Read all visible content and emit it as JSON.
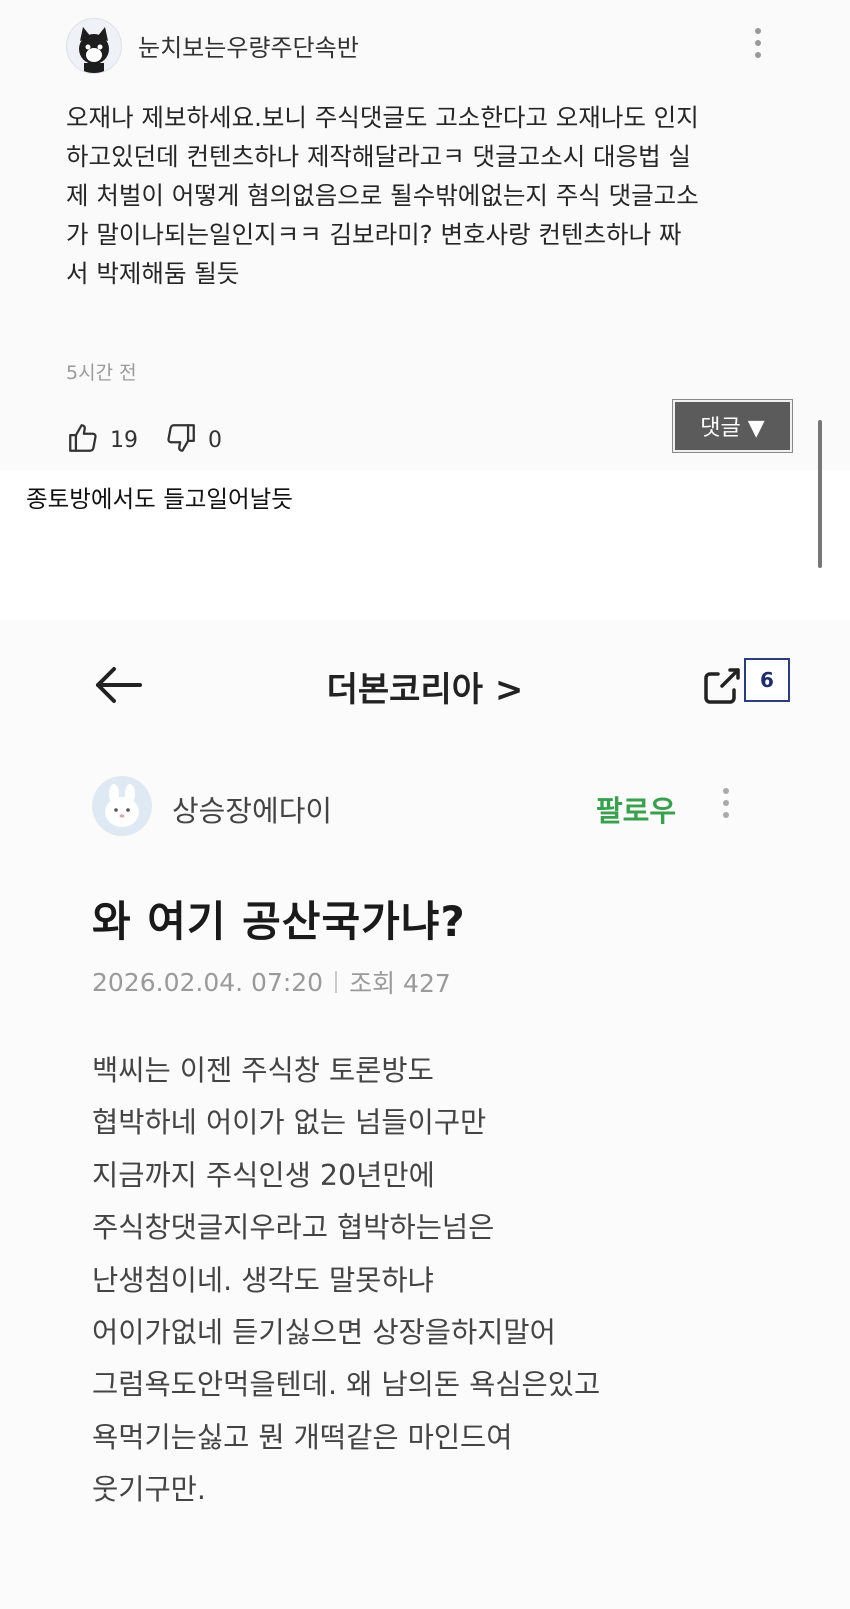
{
  "comment": {
    "username": "눈치보는우량주단속반",
    "lines": [
      "오재나 제보하세요.보니 주식댓글도 고소한다고 오재나도 인지",
      "하고있던데 컨텐츠하나 제작해달라고ㅋ 댓글고소시 대응법 실",
      "제 처벌이 어떻게 혐의없음으로 될수밖에없는지 주식 댓글고소",
      "가 말이나되는일인지ㅋㅋ 김보라미? 변호사랑 컨텐츠하나 짜",
      "서 박제해둠 될듯"
    ],
    "time": "5시간 전",
    "like_count": "19",
    "dislike_count": "0",
    "reply_button_label": "댓글 ▼",
    "icons": [
      "thumbs-up-icon",
      "thumbs-down-icon",
      "more-vertical-icon"
    ]
  },
  "caption": "종토방에서도 들고일어날듯",
  "screenshot": {
    "board_title": "더본코리아 >",
    "share_count": "6",
    "author": "상승장에다이",
    "follow_label": "팔로우",
    "post_title": "와 여기 공산국가냐?",
    "date": "2026.02.04. 07:20",
    "views": "조회 427",
    "body_lines": [
      "백씨는 이젠 주식창 토론방도",
      "협박하네 어이가 없는 넘들이구만",
      "지금까지 주식인생 20년만에",
      "주식창댓글지우라고 협박하는넘은",
      "난생첨이네. 생각도 말못하냐",
      "어이가없네 듣기싫으면 상장을하지말어",
      "그럼욕도안먹을텐데. 왜  남의돈 욕심은있고",
      "욕먹기는싫고 뭔 개떡같은 마인드여",
      "웃기구만."
    ],
    "colors": {
      "follow": "#3aa04f",
      "badge_border": "#2c3e7a"
    }
  }
}
